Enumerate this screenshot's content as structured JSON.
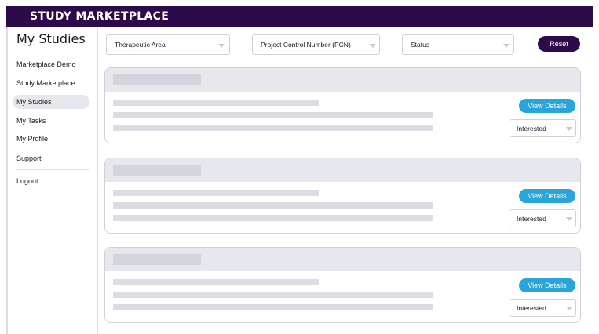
{
  "app": {
    "brand": "STUDY MARKETPLACE",
    "brand_color": "#2d0a4a",
    "accent_color": "#2aa5dc"
  },
  "sidebar": {
    "title": "My Studies",
    "items": [
      {
        "label": "Marketplace Demo"
      },
      {
        "label": "Study Marketplace"
      },
      {
        "label": "My Studies",
        "active": true
      },
      {
        "label": "My Tasks"
      },
      {
        "label": "My Profile"
      },
      {
        "label": "Support"
      },
      {
        "label": "Logout"
      }
    ]
  },
  "filters": {
    "therapeutic_area": {
      "label": "Therapeutic Area",
      "icon": "chevron-down-icon"
    },
    "pcn": {
      "label": "Project Control Number (PCN)",
      "icon": "chevron-down-icon"
    },
    "status": {
      "label": "Status",
      "icon": "chevron-down-icon"
    },
    "reset_label": "Reset"
  },
  "cards": [
    {
      "view_label": "View Details",
      "status_value": "Interested"
    },
    {
      "view_label": "View Details",
      "status_value": "Interested"
    },
    {
      "view_label": "View Details",
      "status_value": "Interested"
    }
  ]
}
